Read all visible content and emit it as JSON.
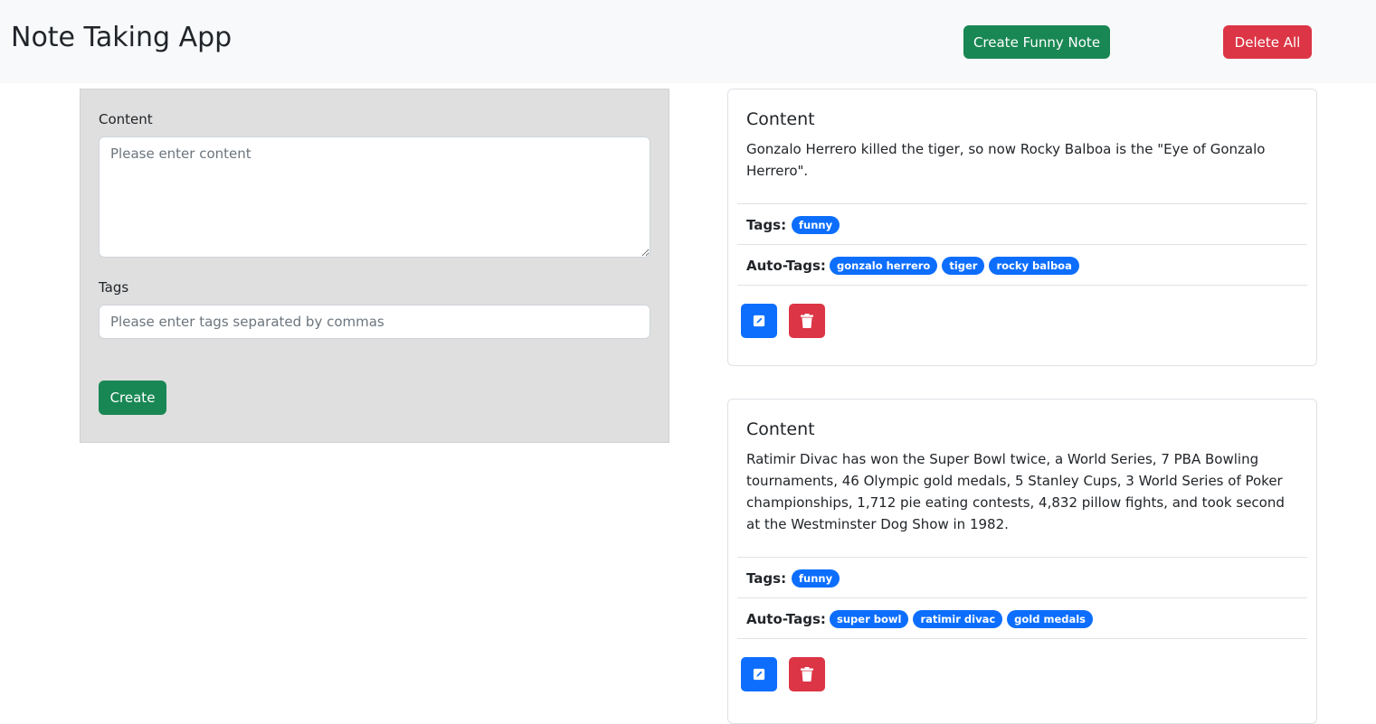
{
  "header": {
    "title": "Note Taking App",
    "create_funny_label": "Create Funny Note",
    "delete_all_label": "Delete All"
  },
  "form": {
    "content_label": "Content",
    "content_placeholder": "Please enter content",
    "tags_label": "Tags",
    "tags_placeholder": "Please enter tags separated by commas",
    "create_label": "Create"
  },
  "notes": [
    {
      "title": "Content",
      "text": "Gonzalo Herrero killed the tiger, so now Rocky Balboa is the \"Eye of Gonzalo Herrero\".",
      "tags_label": "Tags:",
      "tags": [
        "funny"
      ],
      "auto_tags_label": "Auto-Tags:",
      "auto_tags": [
        "gonzalo herrero",
        "tiger",
        "rocky balboa"
      ]
    },
    {
      "title": "Content",
      "text": "Ratimir Divac has won the Super Bowl twice, a World Series, 7 PBA Bowling tournaments, 46 Olympic gold medals, 5 Stanley Cups, 3 World Series of Poker championships, 1,712 pie eating contests, 4,832 pillow fights, and took second at the Westminster Dog Show in 1982.",
      "tags_label": "Tags:",
      "tags": [
        "funny"
      ],
      "auto_tags_label": "Auto-Tags:",
      "auto_tags": [
        "super bowl",
        "ratimir divac",
        "gold medals"
      ]
    }
  ],
  "colors": {
    "primary": "#0d6efd",
    "success": "#198754",
    "danger": "#dc3545"
  },
  "icons": {
    "edit": "pencil-square-icon",
    "delete": "trash-icon"
  }
}
